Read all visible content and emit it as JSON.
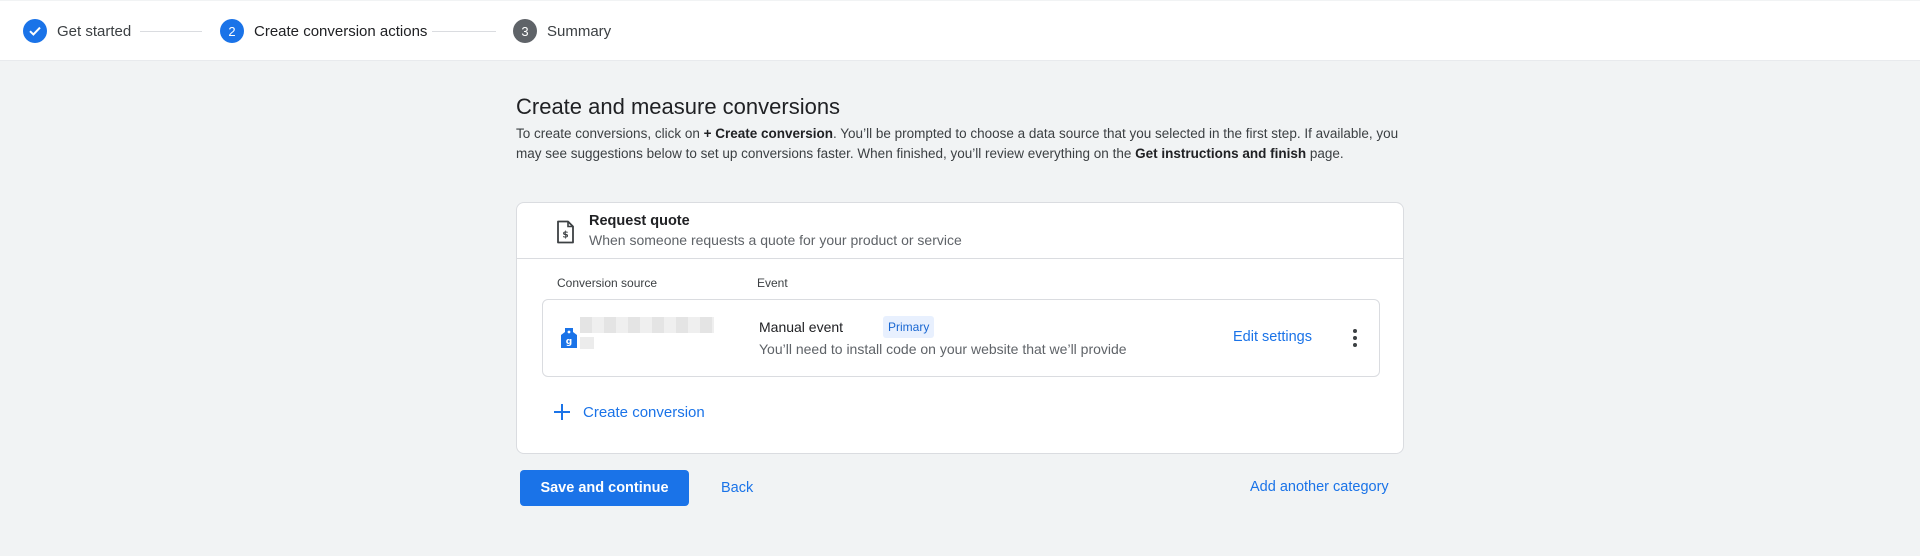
{
  "stepper": {
    "steps": [
      {
        "number": "",
        "label": "Get started",
        "state": "done"
      },
      {
        "number": "2",
        "label": "Create conversion actions",
        "state": "active"
      },
      {
        "number": "3",
        "label": "Summary",
        "state": "todo"
      }
    ]
  },
  "main": {
    "title": "Create and measure conversions",
    "description": {
      "part1": "To create conversions, click on ",
      "bold1": "+ Create conversion",
      "part2": ". You’ll be prompted to choose a data source that you selected in the first step. If available, you may see suggestions below to set up conversions faster. When finished, you’ll review everything on the ",
      "bold2": "Get instructions and finish",
      "part3": " page."
    }
  },
  "category": {
    "title": "Request quote",
    "description": "When someone requests a quote for your product or service",
    "icon": "document-dollar-icon",
    "columns": {
      "source": "Conversion source",
      "event": "Event"
    },
    "conversions": [
      {
        "source_icon": "tag-icon",
        "event_name": "Manual event",
        "badge": "Primary",
        "event_description": "You’ll need to install code on your website that we’ll provide",
        "edit_label": "Edit settings"
      }
    ],
    "create_label": "Create conversion"
  },
  "footer": {
    "save_label": "Save and continue",
    "back_label": "Back",
    "add_category_label": "Add another category"
  },
  "colors": {
    "accent": "#1a73e8",
    "page_bg": "#f1f3f4",
    "badge_bg": "#e8f0fe",
    "step_inactive": "#5f6368"
  }
}
